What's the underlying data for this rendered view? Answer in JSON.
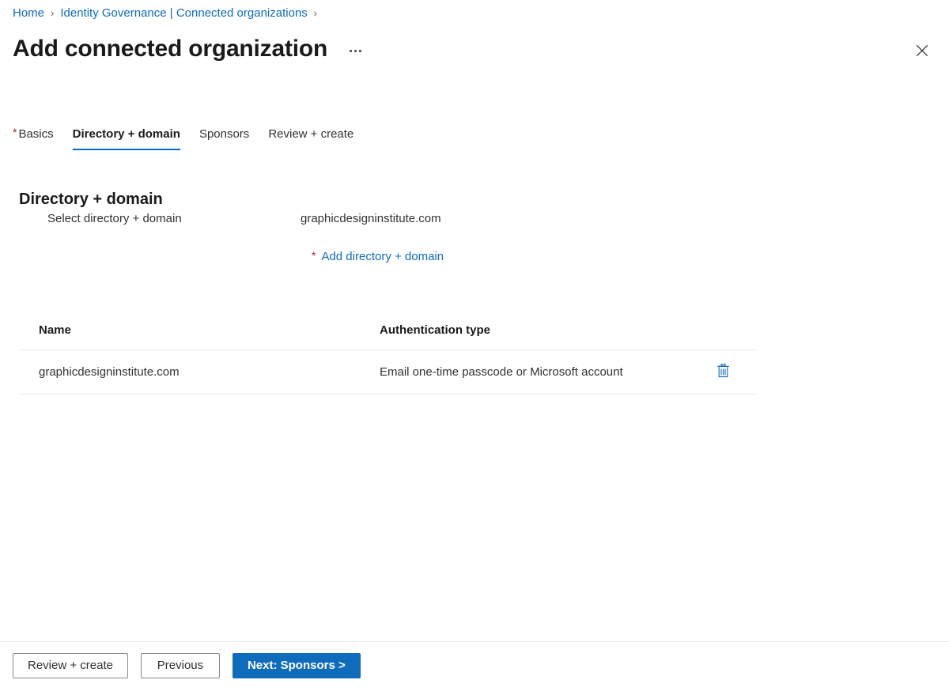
{
  "breadcrumb": {
    "items": [
      {
        "label": "Home"
      },
      {
        "label": "Identity Governance | Connected organizations"
      }
    ],
    "separator": "›"
  },
  "header": {
    "title": "Add connected organization",
    "more_menu": "more-commands",
    "close": "close-icon"
  },
  "tabs": [
    {
      "label": "Basics",
      "required": true,
      "active": false
    },
    {
      "label": "Directory + domain",
      "required": false,
      "active": true
    },
    {
      "label": "Sponsors",
      "required": false,
      "active": false
    },
    {
      "label": "Review + create",
      "required": false,
      "active": false
    }
  ],
  "section": {
    "heading": "Directory + domain",
    "field_label": "Select directory + domain",
    "field_value": "graphicdesigninstitute.com",
    "add_link_star": "*",
    "add_link_label": "Add directory + domain"
  },
  "table": {
    "columns": [
      "Name",
      "Authentication type",
      ""
    ],
    "rows": [
      {
        "name": "graphicdesigninstitute.com",
        "auth_type": "Email one-time passcode or Microsoft account",
        "delete_icon": "trash-icon"
      }
    ]
  },
  "footer": {
    "review_create": "Review + create",
    "previous": "Previous",
    "next": "Next: Sponsors >"
  },
  "colors": {
    "link": "#0f6cbd",
    "primary_button": "#0f6cbd",
    "required_star": "#a4262c",
    "text": "#323130",
    "border": "#edebe9"
  }
}
